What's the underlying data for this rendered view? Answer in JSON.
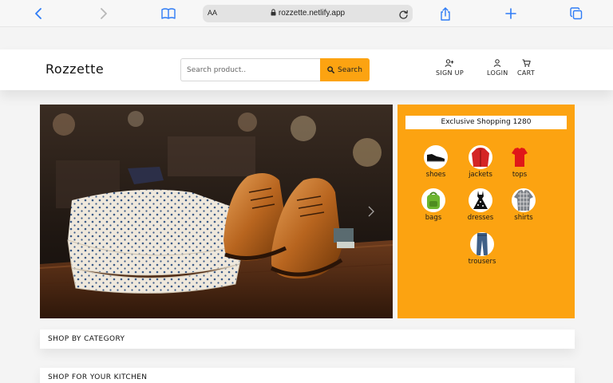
{
  "browser": {
    "url_aa": "AA",
    "url": "rozzette.netlify.app"
  },
  "header": {
    "logo": "Rozzette",
    "search_placeholder": "Search product..",
    "search_button": "Search",
    "nav": {
      "signup": "SIGN UP",
      "login": "LOGIN",
      "cart": "CART"
    }
  },
  "exclusive": {
    "title": "Exclusive Shopping 1280",
    "categories": [
      {
        "label": "shoes",
        "icon": "shoe-icon"
      },
      {
        "label": "jackets",
        "icon": "jacket-icon"
      },
      {
        "label": "tops",
        "icon": "top-icon"
      },
      {
        "label": "bags",
        "icon": "bag-icon"
      },
      {
        "label": "dresses",
        "icon": "dress-icon"
      },
      {
        "label": "shirts",
        "icon": "shirt-icon"
      },
      {
        "label": "trousers",
        "icon": "trousers-icon"
      }
    ]
  },
  "sections": {
    "shop_by_category": "SHOP BY CATEGORY",
    "shop_for_kitchen": "SHOP FOR YOUR KITCHEN"
  },
  "colors": {
    "accent": "#fca311",
    "browser_blue": "#2f7cf6"
  }
}
